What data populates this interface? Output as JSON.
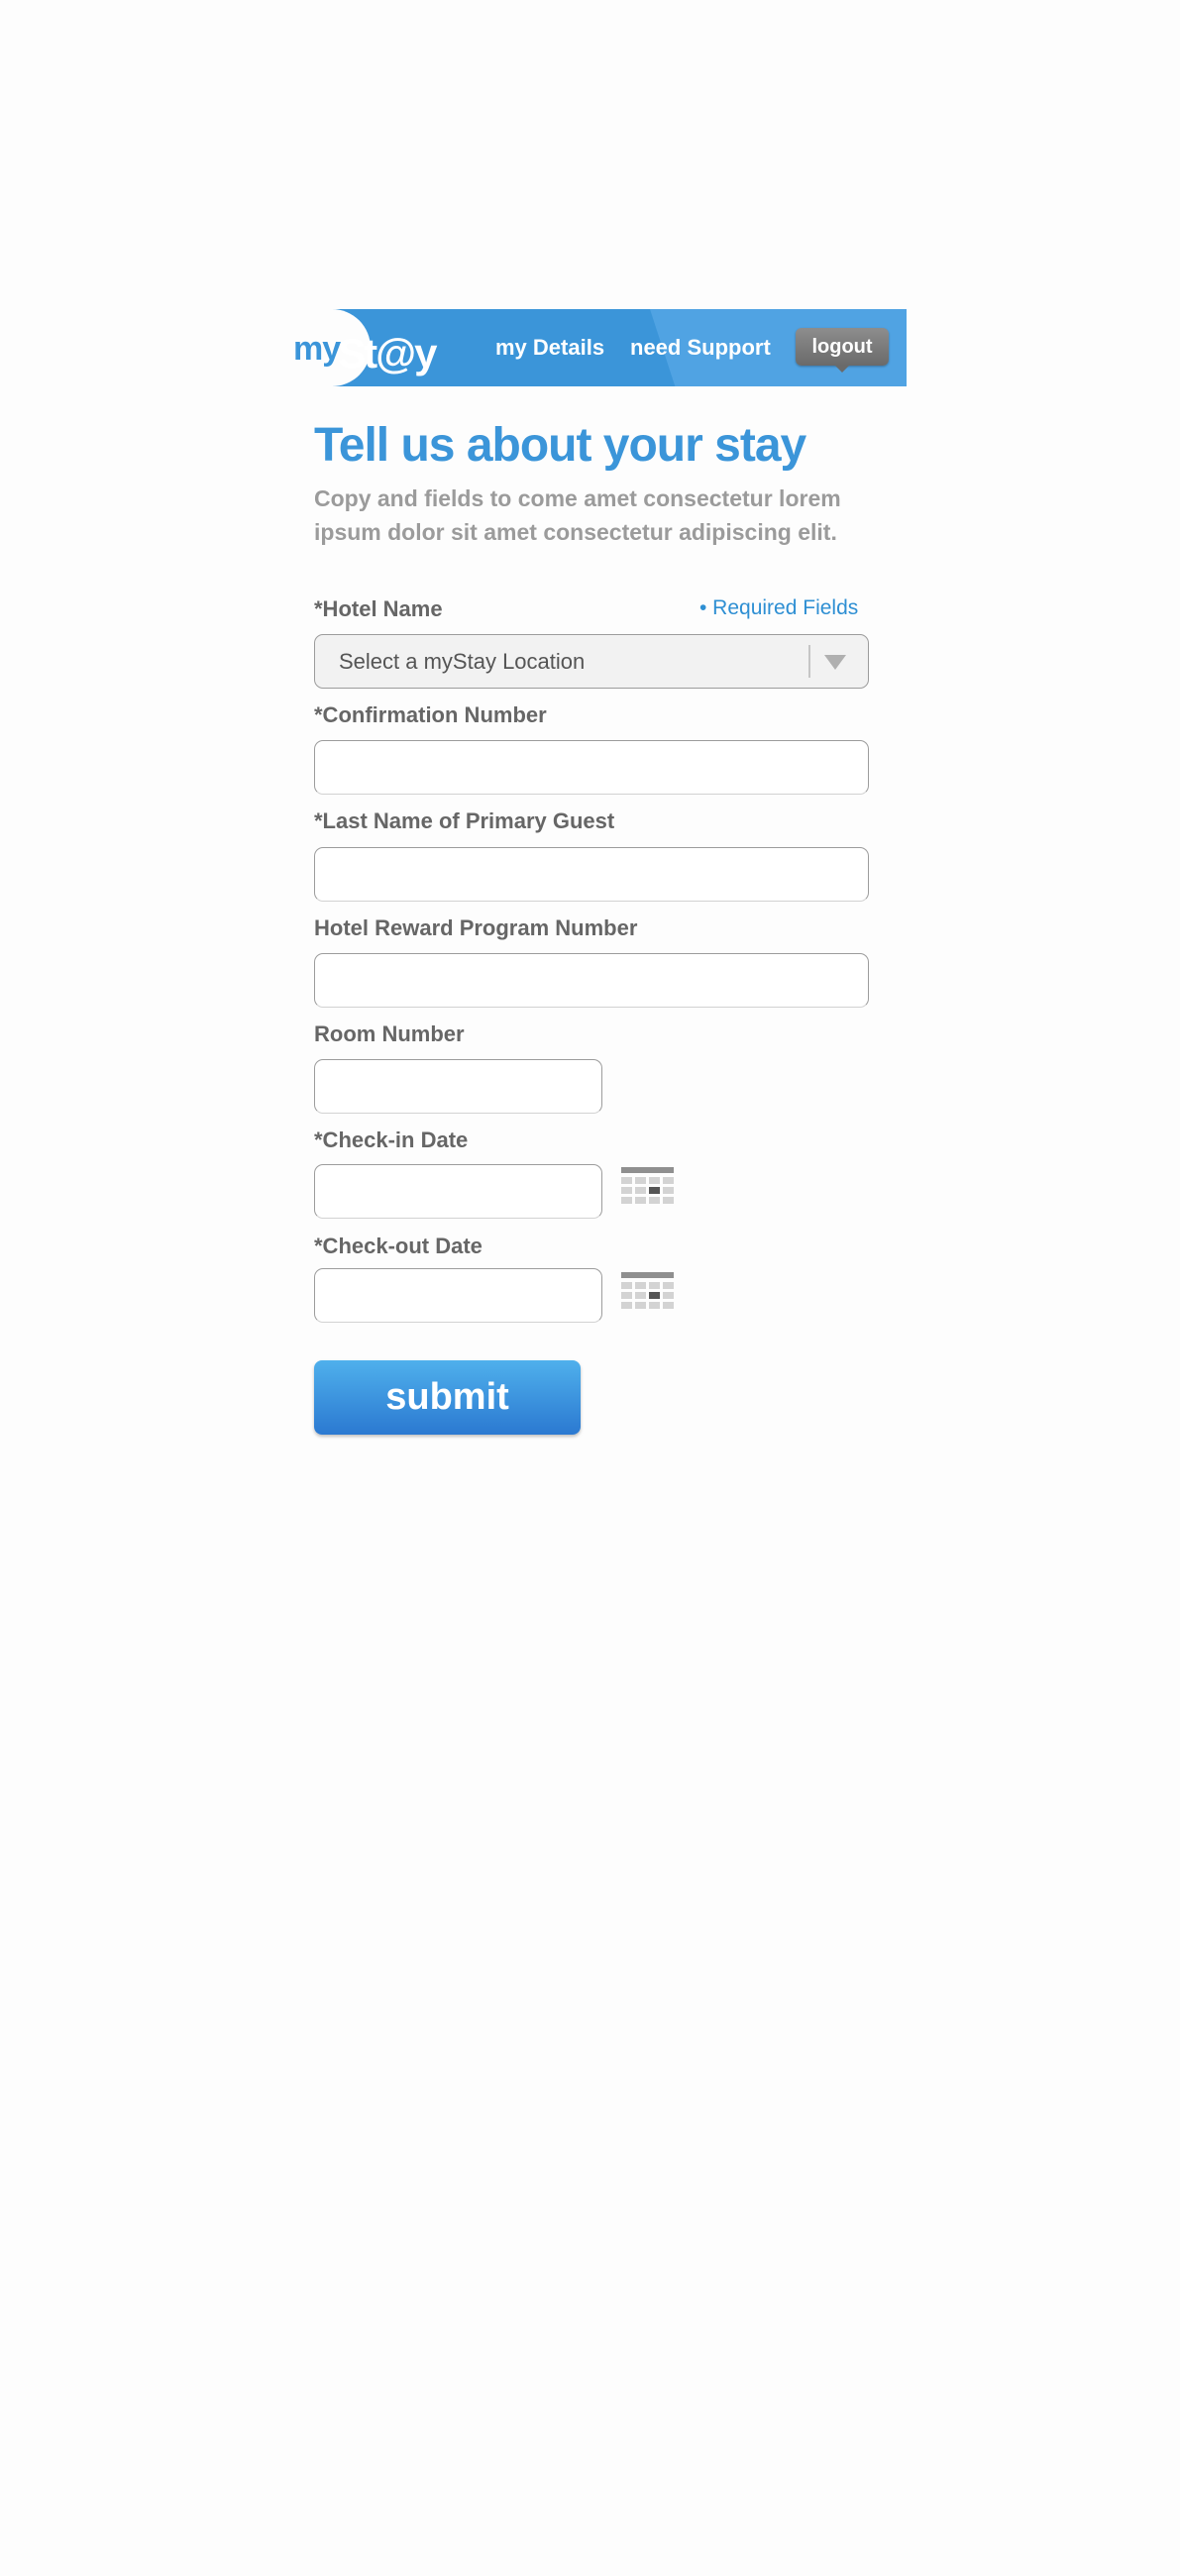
{
  "header": {
    "logo_my": "my",
    "logo_stay": "St@y",
    "nav_details": "my Details",
    "nav_support": "need Support",
    "logout": "logout"
  },
  "intro": {
    "title": "Tell us about your stay",
    "copy": "Copy and fields to come amet consectetur lorem ipsum dolor sit amet consectetur adipiscing elit."
  },
  "form": {
    "required_note": "• Required Fields",
    "hotel_name": {
      "label": "*Hotel Name",
      "selected": "Select a myStay Location"
    },
    "confirmation_number": {
      "label": "*Confirmation Number",
      "value": ""
    },
    "last_name": {
      "label": "*Last Name of Primary Guest",
      "value": ""
    },
    "reward_number": {
      "label": "Hotel Reward Program Number",
      "value": ""
    },
    "room_number": {
      "label": "Room Number",
      "value": ""
    },
    "checkin_date": {
      "label": "*Check-in Date",
      "value": ""
    },
    "checkout_date": {
      "label": "*Check-out Date",
      "value": ""
    },
    "submit_label": "submit"
  },
  "colors": {
    "brand_blue": "#3b95d9",
    "logout_gray": "#7a7a7a",
    "label_gray": "#666666",
    "copy_gray": "#9b9b9b"
  },
  "icons": {
    "calendar": "calendar-icon",
    "dropdown": "chevron-down-icon"
  }
}
